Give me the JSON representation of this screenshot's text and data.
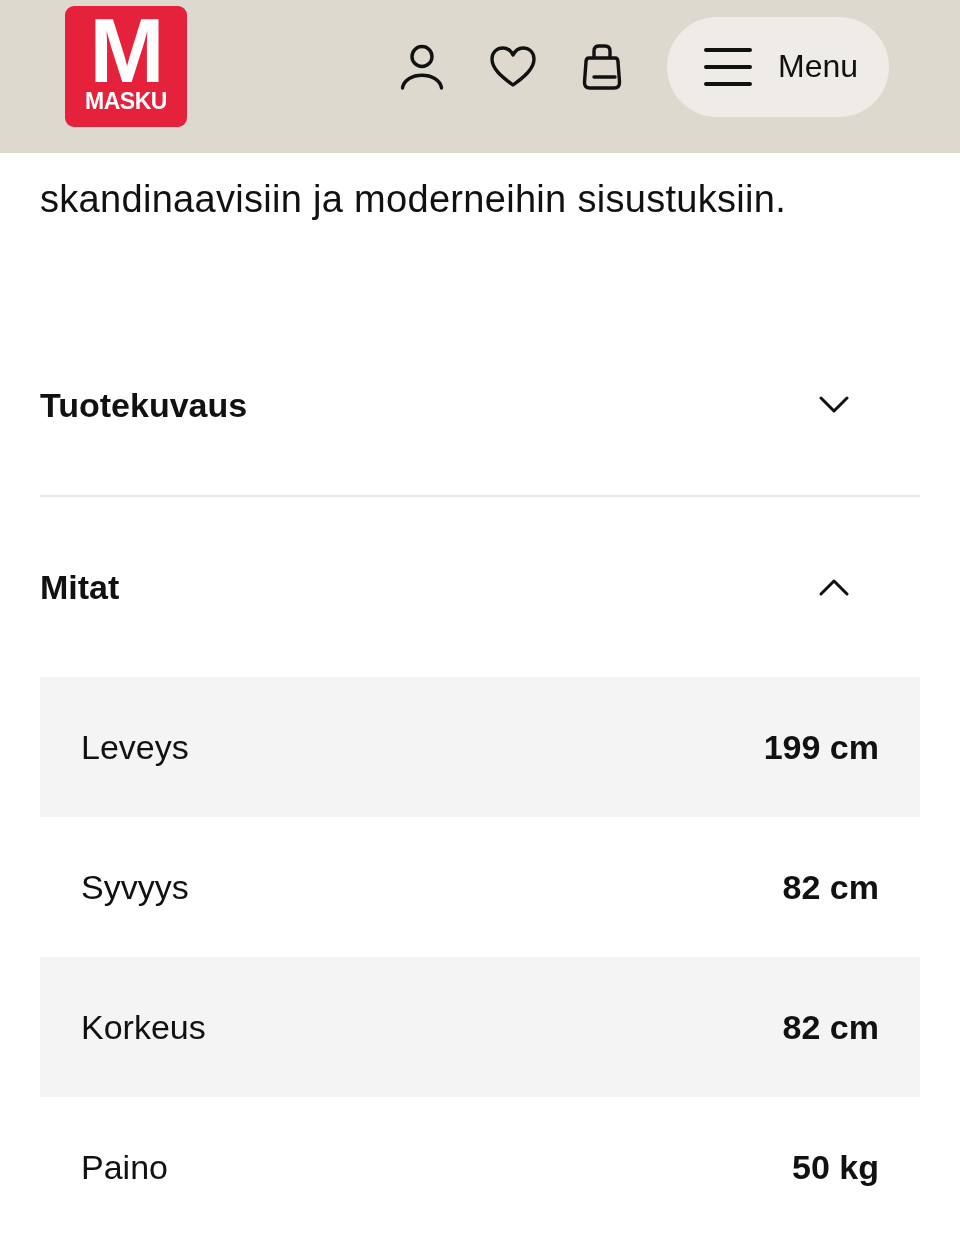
{
  "header": {
    "logo": {
      "mark": "M",
      "wordmark": "MASKU"
    },
    "menu_button": {
      "label": "Menu"
    }
  },
  "intro_text": "skandinaavisiin ja moderneihin sisustuksiin.",
  "accordion": [
    {
      "title": "Tuotekuvaus",
      "expanded": false
    },
    {
      "title": "Mitat",
      "expanded": true,
      "rows": [
        {
          "label": "Leveys",
          "value": "199 cm"
        },
        {
          "label": "Syvyys",
          "value": "82 cm"
        },
        {
          "label": "Korkeus",
          "value": "82 cm"
        },
        {
          "label": "Paino",
          "value": "50 kg"
        }
      ]
    }
  ]
}
